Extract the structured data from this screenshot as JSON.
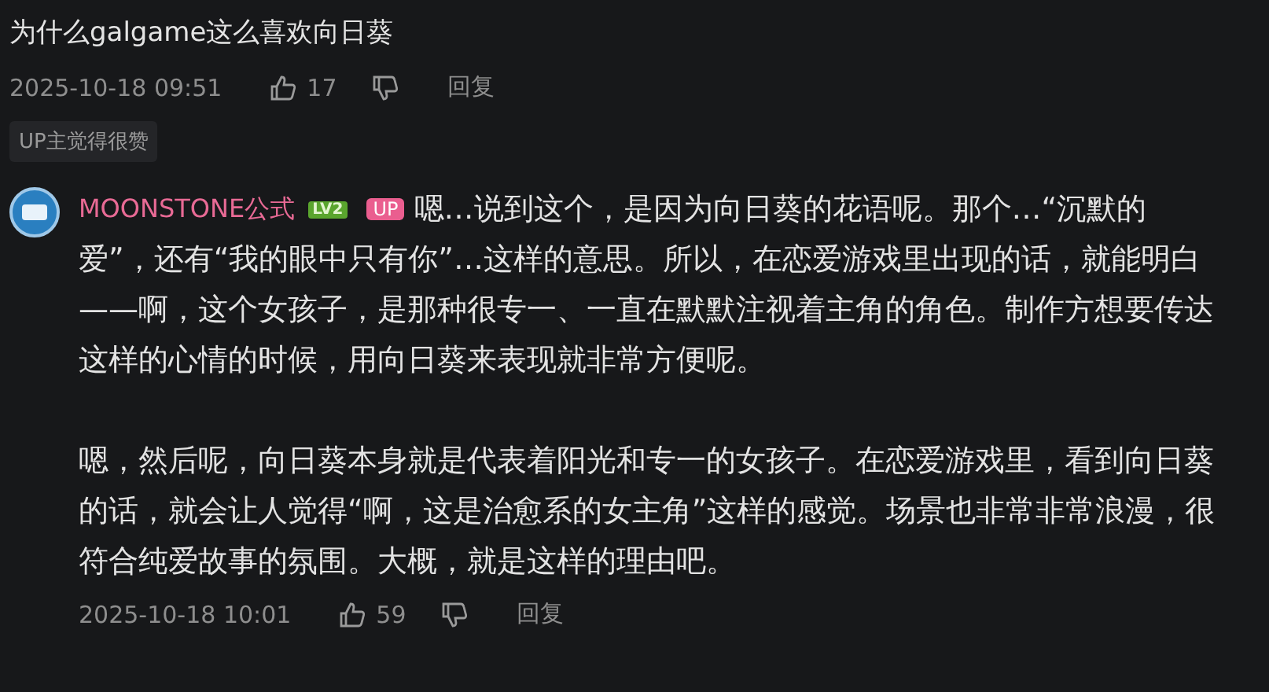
{
  "comment": {
    "title": "为什么galgame这么喜欢向日葵",
    "time": "2025-10-18 09:51",
    "likes": "17",
    "reply_label": "回复",
    "badge": "UP主觉得很赞"
  },
  "reply": {
    "author": "MOONSTONE公式",
    "level": "LV2",
    "up_tag": "UP",
    "first_line": "嗯…说到这个，是因为向日葵的花语呢。那个…“沉默的",
    "paragraphs": [
      "爱”，还有“我的眼中只有你”…这样的意思。所以，在恋爱游戏里出现的话，就能明白——啊，这个女孩子，是那种很专一、一直在默默注视着主角的角色。制作方想要传达这样的心情的时候，用向日葵来表现就非常方便呢。",
      "嗯，然后呢，向日葵本身就是代表着阳光和专一的女孩子。在恋爱游戏里，看到向日葵的话，就会让人觉得“啊，这是治愈系的女主角”这样的感觉。场景也非常非常浪漫，很符合纯爱故事的氛围。大概，就是这样的理由吧。"
    ],
    "time": "2025-10-18 10:01",
    "likes": "59",
    "reply_label": "回复"
  }
}
